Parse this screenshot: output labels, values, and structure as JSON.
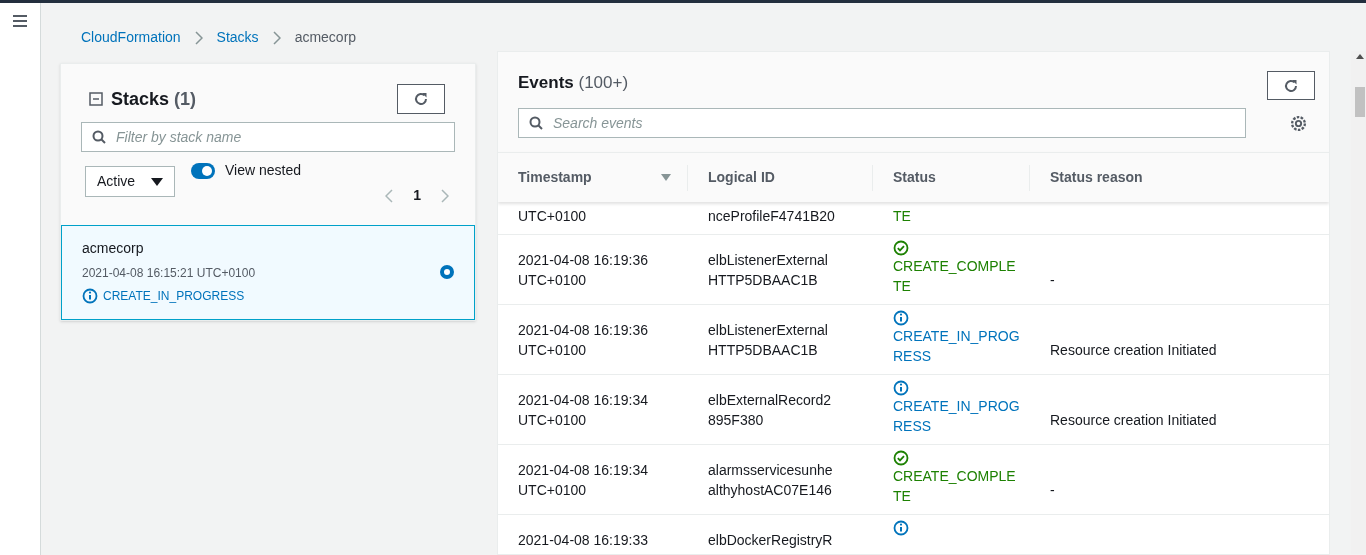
{
  "breadcrumbs": [
    {
      "label": "CloudFormation",
      "link": true
    },
    {
      "label": "Stacks",
      "link": true
    },
    {
      "label": "acmecorp",
      "link": false
    }
  ],
  "stacks_panel": {
    "title": "Stacks",
    "count": "(1)",
    "filter_placeholder": "Filter by stack name",
    "status_filter": "Active",
    "view_nested": {
      "label": "View nested",
      "on": true
    },
    "page": "1",
    "stacks": [
      {
        "name": "acmecorp",
        "created": "2021-04-08 16:15:21 UTC+0100",
        "status": "CREATE_IN_PROGRESS",
        "kind": "progress",
        "selected": true
      }
    ]
  },
  "events_panel": {
    "title": "Events",
    "count": "(100+)",
    "search_placeholder": "Search events",
    "columns": [
      "Timestamp",
      "Logical ID",
      "Status",
      "Status reason"
    ],
    "rows": [
      {
        "timestamp": "UTC+0100",
        "logical_id": "nceProfileF4741B20",
        "status": "TE",
        "kind": "complete",
        "cut": true
      },
      {
        "timestamp": "2021-04-08 16:19:36 UTC+0100",
        "logical_id": "elbListenerExternal HTTP5DBAAC1B",
        "status": "CREATE_COMPLE TE",
        "kind": "complete",
        "reason": "-"
      },
      {
        "timestamp": "2021-04-08 16:19:36 UTC+0100",
        "logical_id": "elbListenerExternal HTTP5DBAAC1B",
        "status": "CREATE_IN_PROG RESS",
        "kind": "progress",
        "reason": "Resource creation Initiated"
      },
      {
        "timestamp": "2021-04-08 16:19:34 UTC+0100",
        "logical_id": "elbExternalRecord2 895F380",
        "status": "CREATE_IN_PROG RESS",
        "kind": "progress",
        "reason": "Resource creation Initiated"
      },
      {
        "timestamp": "2021-04-08 16:19:34 UTC+0100",
        "logical_id": "alarmsservicesunhe althyhostAC07E146",
        "status": "CREATE_COMPLE TE",
        "kind": "complete",
        "reason": "-"
      },
      {
        "timestamp": "2021-04-08 16:19:33",
        "logical_id": "elbDockerRegistryR",
        "kind": "progress"
      }
    ]
  }
}
